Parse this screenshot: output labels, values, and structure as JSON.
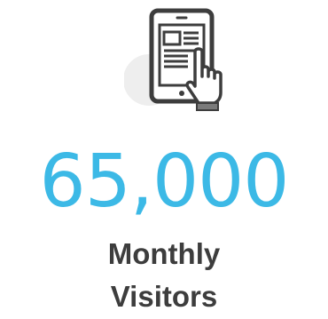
{
  "stat": {
    "icon": "tablet-touch-icon",
    "value": "65,000",
    "label_line_1": "Monthly",
    "label_line_2": "Visitors"
  },
  "colors": {
    "accent": "#3cb9e6",
    "text": "#3d3d3d",
    "icon_stroke": "#3d3d3d",
    "icon_bg_circle": "#eeeeee"
  }
}
